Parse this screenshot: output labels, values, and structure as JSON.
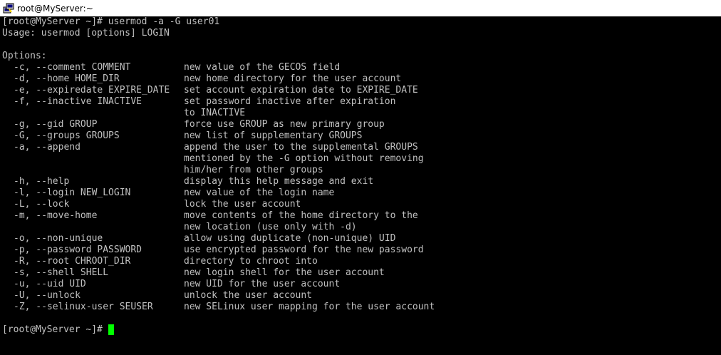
{
  "window": {
    "title": "root@MyServer:~",
    "icon": "putty-terminal-icon"
  },
  "terminal": {
    "command_line": "[root@MyServer ~]# usermod -a -G user01",
    "usage_line": "Usage: usermod [options] LOGIN",
    "options_heading": "Options:",
    "options": [
      {
        "flag": "-c, --comment COMMENT",
        "desc": [
          "new value of the GECOS field"
        ]
      },
      {
        "flag": "-d, --home HOME_DIR",
        "desc": [
          "new home directory for the user account"
        ]
      },
      {
        "flag": "-e, --expiredate EXPIRE_DATE",
        "desc": [
          "set account expiration date to EXPIRE_DATE"
        ]
      },
      {
        "flag": "-f, --inactive INACTIVE",
        "desc": [
          "set password inactive after expiration",
          "to INACTIVE"
        ]
      },
      {
        "flag": "-g, --gid GROUP",
        "desc": [
          "force use GROUP as new primary group"
        ]
      },
      {
        "flag": "-G, --groups GROUPS",
        "desc": [
          "new list of supplementary GROUPS"
        ]
      },
      {
        "flag": "-a, --append",
        "desc": [
          "append the user to the supplemental GROUPS",
          "mentioned by the -G option without removing",
          "him/her from other groups"
        ]
      },
      {
        "flag": "-h, --help",
        "desc": [
          "display this help message and exit"
        ]
      },
      {
        "flag": "-l, --login NEW_LOGIN",
        "desc": [
          "new value of the login name"
        ]
      },
      {
        "flag": "-L, --lock",
        "desc": [
          "lock the user account"
        ]
      },
      {
        "flag": "-m, --move-home",
        "desc": [
          "move contents of the home directory to the",
          "new location (use only with -d)"
        ]
      },
      {
        "flag": "-o, --non-unique",
        "desc": [
          "allow using duplicate (non-unique) UID"
        ]
      },
      {
        "flag": "-p, --password PASSWORD",
        "desc": [
          "use encrypted password for the new password"
        ]
      },
      {
        "flag": "-R, --root CHROOT_DIR",
        "desc": [
          "directory to chroot into"
        ]
      },
      {
        "flag": "-s, --shell SHELL",
        "desc": [
          "new login shell for the user account"
        ]
      },
      {
        "flag": "-u, --uid UID",
        "desc": [
          "new UID for the user account"
        ]
      },
      {
        "flag": "-U, --unlock",
        "desc": [
          "unlock the user account"
        ]
      },
      {
        "flag": "-Z, --selinux-user SEUSER",
        "desc": [
          "new SELinux user mapping for the user account"
        ]
      }
    ],
    "prompt": "[root@MyServer ~]#",
    "cursor_color": "#00ff00",
    "text_color": "#c0c0c0",
    "background_color": "#000000"
  }
}
